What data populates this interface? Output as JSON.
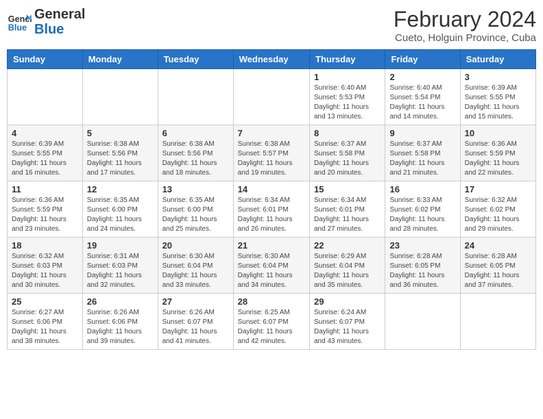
{
  "header": {
    "logo_line1": "General",
    "logo_line2": "Blue",
    "title": "February 2024",
    "subtitle": "Cueto, Holguin Province, Cuba"
  },
  "weekdays": [
    "Sunday",
    "Monday",
    "Tuesday",
    "Wednesday",
    "Thursday",
    "Friday",
    "Saturday"
  ],
  "weeks": [
    [
      {
        "day": "",
        "info": ""
      },
      {
        "day": "",
        "info": ""
      },
      {
        "day": "",
        "info": ""
      },
      {
        "day": "",
        "info": ""
      },
      {
        "day": "1",
        "info": "Sunrise: 6:40 AM\nSunset: 5:53 PM\nDaylight: 11 hours and 13 minutes."
      },
      {
        "day": "2",
        "info": "Sunrise: 6:40 AM\nSunset: 5:54 PM\nDaylight: 11 hours and 14 minutes."
      },
      {
        "day": "3",
        "info": "Sunrise: 6:39 AM\nSunset: 5:55 PM\nDaylight: 11 hours and 15 minutes."
      }
    ],
    [
      {
        "day": "4",
        "info": "Sunrise: 6:39 AM\nSunset: 5:55 PM\nDaylight: 11 hours and 16 minutes."
      },
      {
        "day": "5",
        "info": "Sunrise: 6:38 AM\nSunset: 5:56 PM\nDaylight: 11 hours and 17 minutes."
      },
      {
        "day": "6",
        "info": "Sunrise: 6:38 AM\nSunset: 5:56 PM\nDaylight: 11 hours and 18 minutes."
      },
      {
        "day": "7",
        "info": "Sunrise: 6:38 AM\nSunset: 5:57 PM\nDaylight: 11 hours and 19 minutes."
      },
      {
        "day": "8",
        "info": "Sunrise: 6:37 AM\nSunset: 5:58 PM\nDaylight: 11 hours and 20 minutes."
      },
      {
        "day": "9",
        "info": "Sunrise: 6:37 AM\nSunset: 5:58 PM\nDaylight: 11 hours and 21 minutes."
      },
      {
        "day": "10",
        "info": "Sunrise: 6:36 AM\nSunset: 5:59 PM\nDaylight: 11 hours and 22 minutes."
      }
    ],
    [
      {
        "day": "11",
        "info": "Sunrise: 6:36 AM\nSunset: 5:59 PM\nDaylight: 11 hours and 23 minutes."
      },
      {
        "day": "12",
        "info": "Sunrise: 6:35 AM\nSunset: 6:00 PM\nDaylight: 11 hours and 24 minutes."
      },
      {
        "day": "13",
        "info": "Sunrise: 6:35 AM\nSunset: 6:00 PM\nDaylight: 11 hours and 25 minutes."
      },
      {
        "day": "14",
        "info": "Sunrise: 6:34 AM\nSunset: 6:01 PM\nDaylight: 11 hours and 26 minutes."
      },
      {
        "day": "15",
        "info": "Sunrise: 6:34 AM\nSunset: 6:01 PM\nDaylight: 11 hours and 27 minutes."
      },
      {
        "day": "16",
        "info": "Sunrise: 6:33 AM\nSunset: 6:02 PM\nDaylight: 11 hours and 28 minutes."
      },
      {
        "day": "17",
        "info": "Sunrise: 6:32 AM\nSunset: 6:02 PM\nDaylight: 11 hours and 29 minutes."
      }
    ],
    [
      {
        "day": "18",
        "info": "Sunrise: 6:32 AM\nSunset: 6:03 PM\nDaylight: 11 hours and 30 minutes."
      },
      {
        "day": "19",
        "info": "Sunrise: 6:31 AM\nSunset: 6:03 PM\nDaylight: 11 hours and 32 minutes."
      },
      {
        "day": "20",
        "info": "Sunrise: 6:30 AM\nSunset: 6:04 PM\nDaylight: 11 hours and 33 minutes."
      },
      {
        "day": "21",
        "info": "Sunrise: 6:30 AM\nSunset: 6:04 PM\nDaylight: 11 hours and 34 minutes."
      },
      {
        "day": "22",
        "info": "Sunrise: 6:29 AM\nSunset: 6:04 PM\nDaylight: 11 hours and 35 minutes."
      },
      {
        "day": "23",
        "info": "Sunrise: 6:28 AM\nSunset: 6:05 PM\nDaylight: 11 hours and 36 minutes."
      },
      {
        "day": "24",
        "info": "Sunrise: 6:28 AM\nSunset: 6:05 PM\nDaylight: 11 hours and 37 minutes."
      }
    ],
    [
      {
        "day": "25",
        "info": "Sunrise: 6:27 AM\nSunset: 6:06 PM\nDaylight: 11 hours and 38 minutes."
      },
      {
        "day": "26",
        "info": "Sunrise: 6:26 AM\nSunset: 6:06 PM\nDaylight: 11 hours and 39 minutes."
      },
      {
        "day": "27",
        "info": "Sunrise: 6:26 AM\nSunset: 6:07 PM\nDaylight: 11 hours and 41 minutes."
      },
      {
        "day": "28",
        "info": "Sunrise: 6:25 AM\nSunset: 6:07 PM\nDaylight: 11 hours and 42 minutes."
      },
      {
        "day": "29",
        "info": "Sunrise: 6:24 AM\nSunset: 6:07 PM\nDaylight: 11 hours and 43 minutes."
      },
      {
        "day": "",
        "info": ""
      },
      {
        "day": "",
        "info": ""
      }
    ]
  ]
}
